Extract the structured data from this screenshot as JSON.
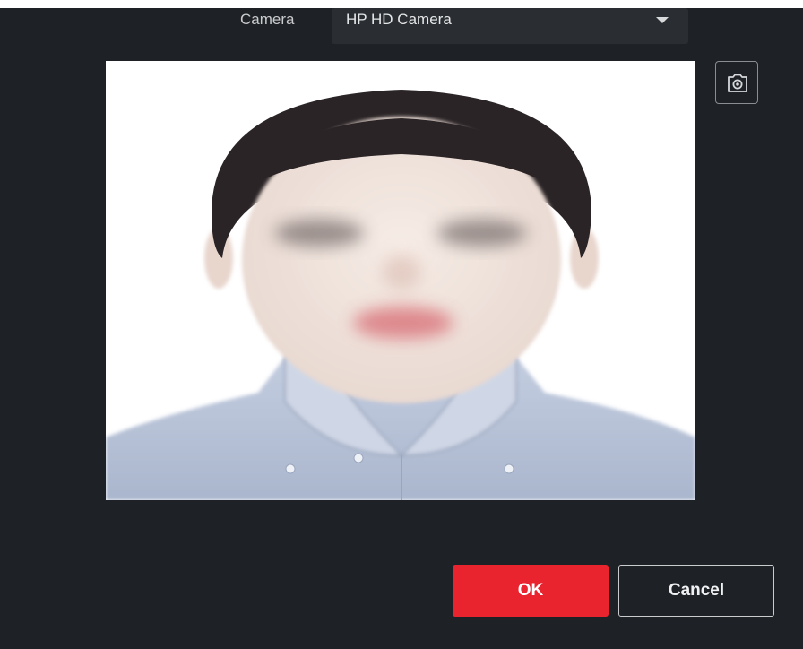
{
  "camera": {
    "label": "Camera",
    "selected": "HP HD Camera"
  },
  "icons": {
    "dropdown": "caret-down-icon",
    "snapshot": "camera-icon"
  },
  "preview": {
    "image": "portrait-photo"
  },
  "buttons": {
    "ok": "OK",
    "cancel": "Cancel"
  },
  "colors": {
    "dialog_bg": "#1e2125",
    "primary": "#e9242f"
  }
}
